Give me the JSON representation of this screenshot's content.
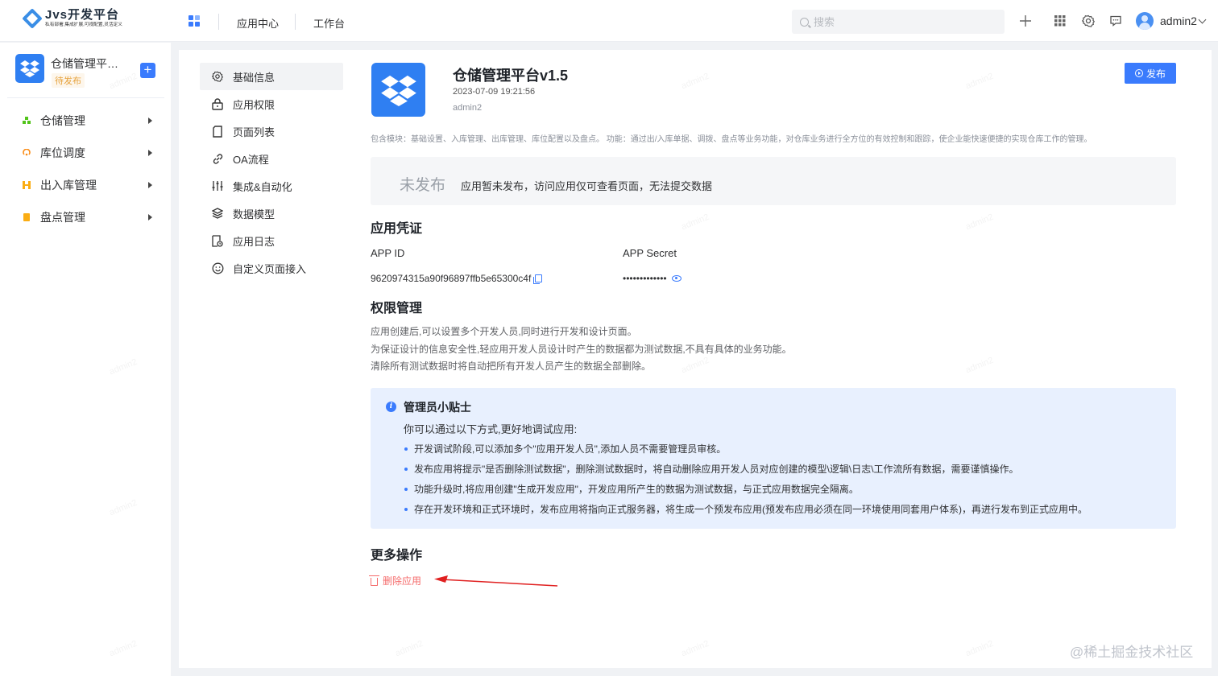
{
  "brand": {
    "title": "Jvs开发平台",
    "subtitle": "私有部署,集成扩展,可视配置,灵活定义",
    "colors": {
      "primary": "#3a7bfd",
      "danger": "#f56c6c",
      "warning": "#e6a23c"
    }
  },
  "topnav": {
    "links": [
      "应用中心",
      "工作台"
    ],
    "search_placeholder": "搜索",
    "icons": [
      "plus-icon",
      "apps-grid-icon",
      "gear-icon",
      "message-icon"
    ],
    "user": "admin2"
  },
  "sidebar": {
    "app_name": "仓储管理平…",
    "status_badge": "待发布",
    "add_label": "+",
    "items": [
      {
        "label": "仓储管理",
        "icon": "warehouse-icon",
        "color": "#52c41a"
      },
      {
        "label": "库位调度",
        "icon": "dispatch-icon",
        "color": "#fa8c16"
      },
      {
        "label": "出入库管理",
        "icon": "inout-icon",
        "color": "#faad14"
      },
      {
        "label": "盘点管理",
        "icon": "inventory-icon",
        "color": "#faad14"
      }
    ]
  },
  "subnav": {
    "items": [
      {
        "label": "基础信息",
        "icon": "gear-icon"
      },
      {
        "label": "应用权限",
        "icon": "lock-icon"
      },
      {
        "label": "页面列表",
        "icon": "page-icon"
      },
      {
        "label": "OA流程",
        "icon": "link-icon"
      },
      {
        "label": "集成&自动化",
        "icon": "sliders-icon"
      },
      {
        "label": "数据模型",
        "icon": "layers-icon"
      },
      {
        "label": "应用日志",
        "icon": "log-icon"
      },
      {
        "label": "自定义页面接入",
        "icon": "smile-icon"
      }
    ]
  },
  "app": {
    "title": "仓储管理平台v1.5",
    "created_at": "2023-07-09 19:21:56",
    "owner": "admin2",
    "publish_label": "发布",
    "description": "包含模块：基础设置、入库管理、出库管理、库位配置以及盘点。 功能：通过出/入库单据、调拨、盘点等业务功能，对仓库业务进行全方位的有效控制和跟踪，使企业能快速便捷的实现仓库工作的管理。"
  },
  "status": {
    "title": "未发布",
    "text": "应用暂未发布，访问应用仅可查看页面，无法提交数据"
  },
  "credentials": {
    "title": "应用凭证",
    "app_id_label": "APP ID",
    "app_id": "9620974315a90f96897ffb5e65300c4f",
    "secret_label": "APP Secret",
    "secret": "•••••••••••••"
  },
  "permissions": {
    "title": "权限管理",
    "lines": [
      "应用创建后,可以设置多个开发人员,同时进行开发和设计页面。",
      "为保证设计的信息安全性,轻应用开发人员设计时产生的数据都为测试数据,不具有具体的业务功能。",
      "清除所有测试数据时将自动把所有开发人员产生的数据全部删除。"
    ]
  },
  "tips": {
    "title": "管理员小贴士",
    "subtitle": "你可以通过以下方式,更好地调试应用:",
    "items": [
      "开发调试阶段,可以添加多个\"应用开发人员\",添加人员不需要管理员审核。",
      "发布应用将提示\"是否删除测试数据\"，删除测试数据时，将自动删除应用开发人员对应创建的模型\\逻辑\\日志\\工作流所有数据，需要谨慎操作。",
      "功能升级时,将应用创建\"生成开发应用\"，开发应用所产生的数据为测试数据，与正式应用数据完全隔离。",
      "存在开发环境和正式环境时，发布应用将指向正式服务器，将生成一个预发布应用(预发布应用必须在同一环境使用同套用户体系)，再进行发布到正式应用中。"
    ]
  },
  "more": {
    "title": "更多操作",
    "delete_label": "删除应用"
  },
  "watermark": "admin2",
  "footer_mark": "@稀土掘金技术社区"
}
